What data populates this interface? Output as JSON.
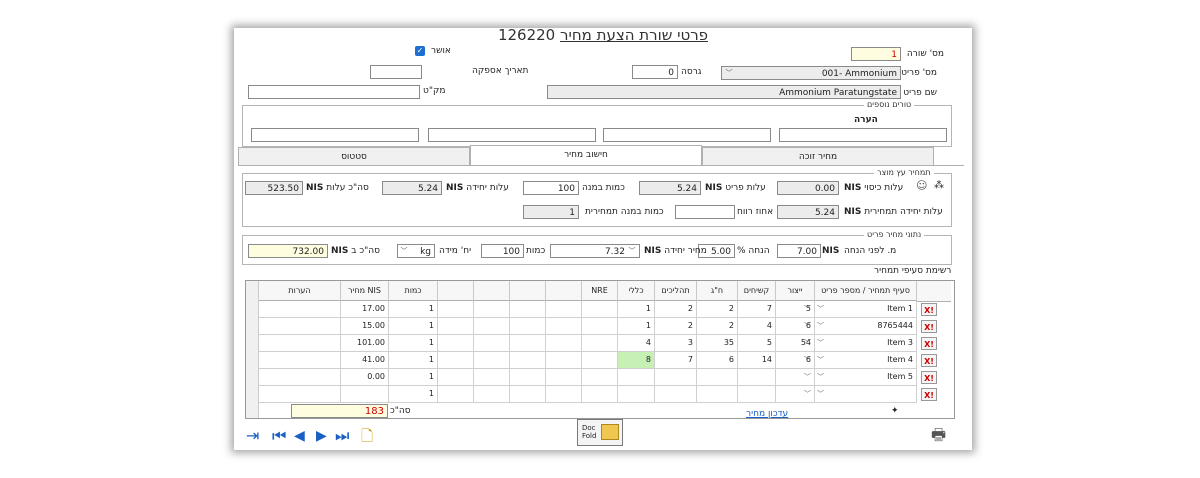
{
  "window": {
    "title": "פרטי שורת הצעת מחיר",
    "title_link": "126220"
  },
  "header": {
    "approved_label": "אושר",
    "line_no_label": "מס' שורה",
    "line_no_value": "1",
    "supply_date_label": "תאריך אספקה",
    "supply_date_value": "",
    "version_label": "גרסה",
    "version_value": "0",
    "part_no_label": "מס' פריט",
    "part_no_value": "001- Ammonium",
    "makat_label": "מק\"ט",
    "makat_value": "",
    "part_name_label": "שם פריט",
    "part_name_value": "Ammonium Paratungstate",
    "extra_fields_legend": "טורים נוספים",
    "note_label": "הערה"
  },
  "tabs": [
    {
      "label": "מחיר זוכה",
      "active": false
    },
    {
      "label": "חישוב מחיר",
      "active": true
    },
    {
      "label": "סטטוס",
      "active": false
    }
  ],
  "cost": {
    "legend": "תמחיר עץ מוצר",
    "currency": "NIS",
    "cover_cost_label": "עלות כיסוי",
    "cover_cost_value": "0.00",
    "part_cost_label": "עלות פריט",
    "part_cost_value": "5.24",
    "qty_batch_label": "כמות במנה",
    "qty_batch_value": "100",
    "unit_cost_label": "עלות יחידה",
    "unit_cost_value": "5.24",
    "total_cost_label": "סה\"כ עלות",
    "total_cost_value": "523.50",
    "unit_cost_calc_label": "עלות יחידה תמחירית",
    "unit_cost_calc_value": "5.24",
    "profit_pct_label": "אחוז רווח",
    "profit_pct_value": "",
    "qty_batch_calc_label": "כמות במנה תמחירית",
    "qty_batch_calc_value": "1"
  },
  "price": {
    "legend": "נתוני מחיר פריט",
    "before_discount_label": "מ. לפני הנחה",
    "before_discount_value": "7.00",
    "discount_pct_label": "% הנחה",
    "discount_pct_value": "5.00",
    "unit_price_label": "מחיר יחידה",
    "unit_price_value": "7.32",
    "qty_label": "כמות",
    "qty_value": "100",
    "unit_measure_label": "יח' מידה",
    "unit_measure_value": "kg",
    "total_label": "סה\"כ ב",
    "total_value": "732.00"
  },
  "list": {
    "title": "רשימת סעיפי תמחיר",
    "columns": [
      "סעיף תמחיר / מספר פריט",
      "ייצור",
      "קשיחים",
      "ח\"ג",
      "תהליכים",
      "כללי",
      "NRE",
      "",
      "",
      "",
      "",
      "כמות",
      "מחיר NIS",
      "הערות"
    ],
    "rows": [
      {
        "item": "Item 1",
        "production": "5",
        "hard": "7",
        "hg": "2",
        "process": "2",
        "general": "1",
        "qty": "1",
        "price": "17.00"
      },
      {
        "item": "8765444",
        "production": "6",
        "hard": "4",
        "hg": "2",
        "process": "2",
        "general": "1",
        "qty": "1",
        "price": "15.00"
      },
      {
        "item": "Item 3",
        "production": "54",
        "hard": "5",
        "hg": "35",
        "process": "3",
        "general": "4",
        "qty": "1",
        "price": "101.00"
      },
      {
        "item": "Item 4",
        "production": "6",
        "hard": "14",
        "hg": "6",
        "process": "7",
        "general": "8",
        "qty": "1",
        "price": "41.00"
      },
      {
        "item": "Item 5",
        "production": "",
        "hard": "",
        "hg": "",
        "process": "",
        "general": "",
        "qty": "1",
        "price": "0.00"
      },
      {
        "item": "",
        "production": "",
        "hard": "",
        "hg": "",
        "process": "",
        "general": "",
        "qty": "1",
        "price": ""
      }
    ],
    "delete_label": "X!",
    "sum_label": "סה\"כ",
    "sum_value": "183",
    "update_price_link": "עדכון מחיר"
  },
  "footer": {
    "doc_btn_line1": "Doc",
    "doc_btn_line2": "Fold"
  },
  "colors": {
    "accent": "#1a5fc4",
    "highlight": "#c6f0b4",
    "yellow": "#fffde0",
    "red": "#d00000"
  }
}
